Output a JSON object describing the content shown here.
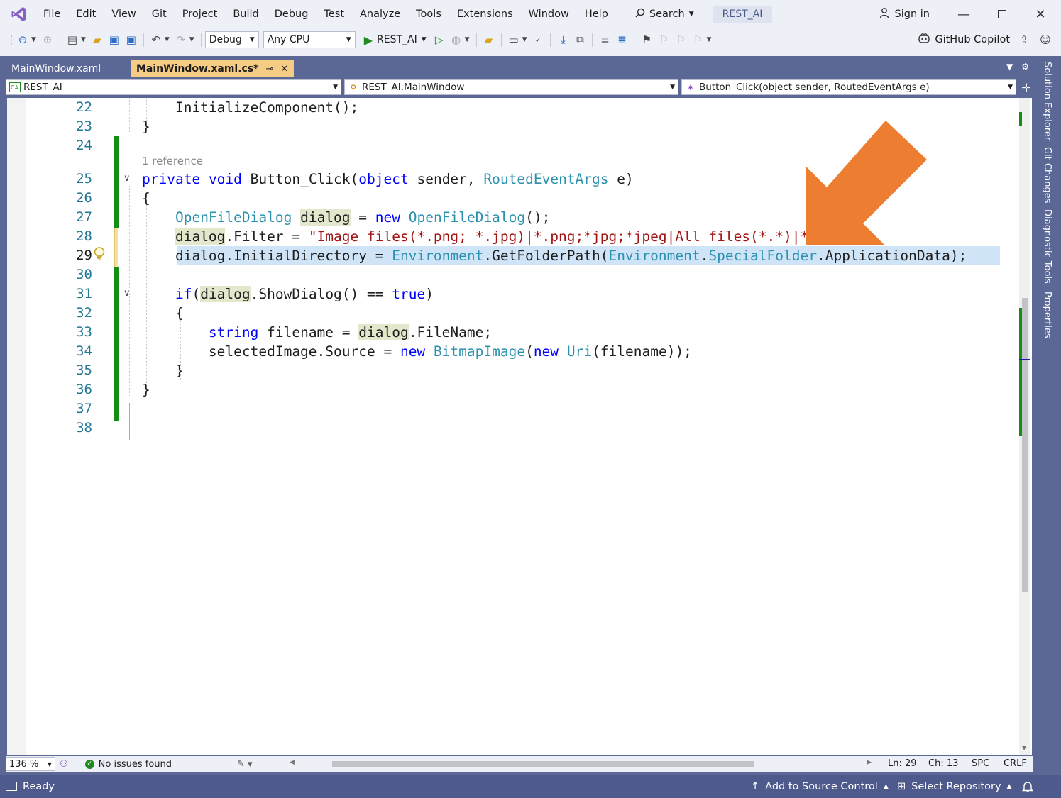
{
  "menu": {
    "items": [
      "File",
      "Edit",
      "View",
      "Git",
      "Project",
      "Build",
      "Debug",
      "Test",
      "Analyze",
      "Tools",
      "Extensions",
      "Window",
      "Help"
    ],
    "search_label": "Search",
    "project_name": "REST_AI",
    "sign_in": "Sign in"
  },
  "toolbar": {
    "config": "Debug",
    "platform": "Any CPU",
    "run_target": "REST_AI",
    "copilot": "GitHub Copilot"
  },
  "tabs": [
    {
      "label": "MainWindow.xaml",
      "active": false
    },
    {
      "label": "MainWindow.xaml.cs*",
      "active": true
    }
  ],
  "navbar": {
    "project": "REST_AI",
    "type": "REST_AI.MainWindow",
    "member": "Button_Click(object sender, RoutedEventArgs e)"
  },
  "editor": {
    "line_numbers": [
      "22",
      "23",
      "24",
      "25",
      "26",
      "27",
      "28",
      "29",
      "30",
      "31",
      "32",
      "33",
      "34",
      "35",
      "36",
      "37",
      "38"
    ],
    "current_line": "29",
    "codelens": "1 reference"
  },
  "editor_status": {
    "zoom": "136 %",
    "issues": "No issues found",
    "ln": "Ln: 29",
    "ch": "Ch: 13",
    "spc": "SPC",
    "crlf": "CRLF"
  },
  "right_tabs": [
    "Solution Explorer",
    "Git Changes",
    "Diagnostic Tools",
    "Properties"
  ],
  "statusbar": {
    "ready": "Ready",
    "source_control": "Add to Source Control",
    "repository": "Select Repository"
  },
  "colors": {
    "accent": "#5b6795",
    "active_tab": "#f5cc84",
    "annotation_arrow": "#ed7d31",
    "keyword": "#0000ff",
    "type": "#2b91af",
    "string": "#a31515"
  }
}
